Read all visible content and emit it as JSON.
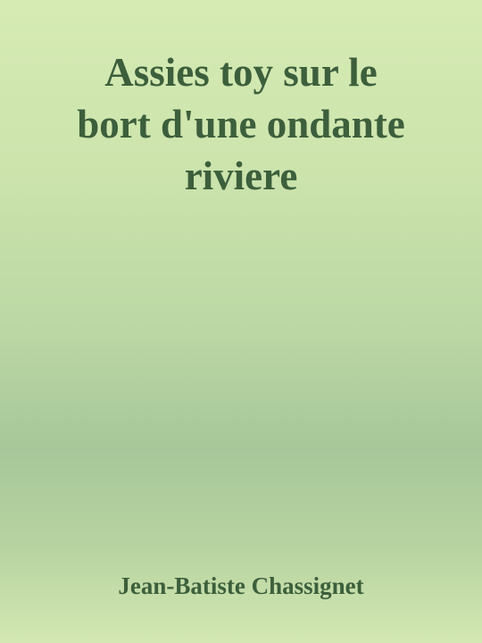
{
  "cover": {
    "title_lines": [
      "Assies toy sur le",
      "bort d'une ondante",
      "riviere"
    ],
    "author": "Jean-Batiste Chassignet"
  },
  "colors": {
    "text": "#3c5f3c",
    "background_top": "#d6ebb4",
    "background_middle": "#a7c79a",
    "background_bottom": "#d3e8b3"
  }
}
